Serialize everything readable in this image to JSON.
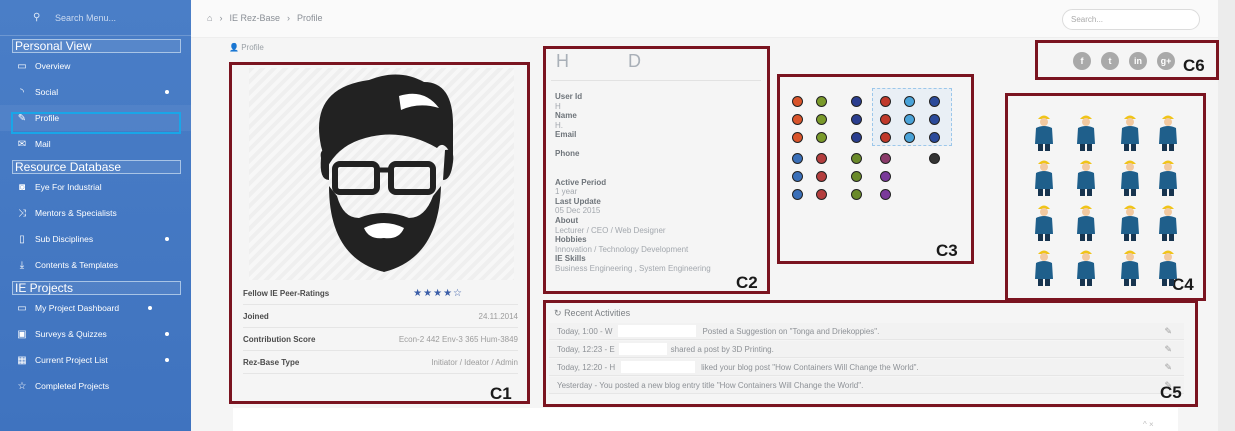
{
  "sidebar": {
    "search_placeholder": "Search Menu...",
    "sections": {
      "personal": "Personal View",
      "resource": "Resource Database",
      "projects": "IE Projects"
    },
    "items": [
      {
        "label": "Overview",
        "icon": "monitor-icon"
      },
      {
        "label": "Social",
        "icon": "rss-icon"
      },
      {
        "label": "Profile",
        "icon": "edit-icon"
      },
      {
        "label": "Mail",
        "icon": "envelope-icon"
      },
      {
        "label": "Eye For Industrial",
        "icon": "camera-icon"
      },
      {
        "label": "Mentors & Specialists",
        "icon": "shuffle-icon"
      },
      {
        "label": "Sub Disciplines",
        "icon": "file-icon"
      },
      {
        "label": "Contents & Templates",
        "icon": "download-icon"
      },
      {
        "label": "My Project Dashboard",
        "icon": "desktop-icon"
      },
      {
        "label": "Surveys & Quizzes",
        "icon": "list-icon"
      },
      {
        "label": "Current Project List",
        "icon": "grid-icon"
      },
      {
        "label": "Completed Projects",
        "icon": "star-icon"
      }
    ]
  },
  "breadcrumb": [
    "IE Rez-Base",
    "Profile"
  ],
  "top_search_placeholder": "Search...",
  "profile": {
    "heading": "Profile",
    "peer_ratings_label": "Fellow IE Peer-Ratings",
    "peer_ratings_stars": "★★★★☆",
    "joined_label": "Joined",
    "joined_value": "24.11.2014",
    "contribution_label": "Contribution Score",
    "contribution_value": "Econ-2 442 Env-3 365 Hum-3849",
    "type_label": "Rez-Base Type",
    "type_value": "Initiator / Ideator / Admin"
  },
  "details": {
    "initial_first": "H",
    "initial_last": "D",
    "user_id_label": "User Id",
    "user_id_value": "H",
    "name_label": "Name",
    "name_value": "H.",
    "email_label": "Email",
    "phone_label": "Phone",
    "active_label": "Active Period",
    "active_value": "1 year",
    "update_label": "Last Update",
    "update_value": "05 Dec 2015",
    "about_label": "About",
    "about_value": "Lecturer / CEO / Web Designer",
    "hobbies_label": "Hobbies",
    "hobbies_value": "Innovation / Technology Development",
    "skills_label": "IE Skills",
    "skills_value": "Business Engineering , System Engineering"
  },
  "social_icons": [
    "f",
    "t",
    "in",
    "g+"
  ],
  "activities": {
    "heading": "Recent Activities",
    "rows": [
      {
        "prefix": "Today, 1:00 - W",
        "text": "Posted a Suggestion on \"Tonga and Driekoppies\"."
      },
      {
        "prefix": "Today, 12:23 - E",
        "text": "shared a post by 3D Printing."
      },
      {
        "prefix": "Today, 12:20 - H",
        "text": "liked your blog post \"How Containers Will Change the World\"."
      },
      {
        "prefix": "Yesterday - You posted a new blog entry title \"How Containers Will Change the World\".",
        "text": ""
      }
    ]
  },
  "callouts": [
    "C1",
    "C2",
    "C3",
    "C4",
    "C5",
    "C6"
  ],
  "colors": {
    "sidebar_blue": "#4378c3",
    "highlight_blue": "#19a6e8",
    "callout_red": "#7a1420",
    "star_blue": "#3b5ea8"
  },
  "bottom_controls": "^ ×"
}
